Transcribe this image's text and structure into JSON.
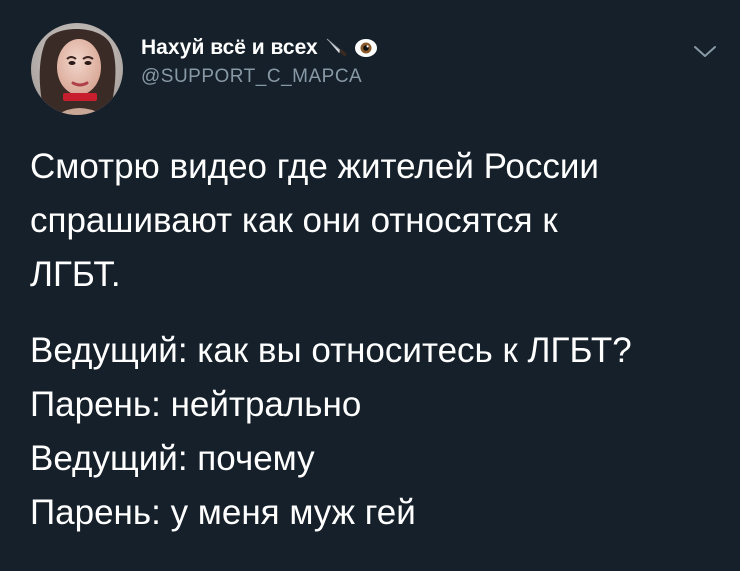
{
  "tweet": {
    "author": {
      "display_name": "Нахуй всё и всех",
      "name_emojis": [
        "knife-icon",
        "eye-icon"
      ],
      "handle": "@SUPPORT_C_MAPCA"
    },
    "paragraph_1": [
      "Смотрю видео где жителей России",
      "спрашивают как они относятся к",
      "ЛГБТ."
    ],
    "paragraph_2": [
      "Ведущий: как вы относитесь к ЛГБТ?",
      "Парень: нейтрально",
      "Ведущий: почему",
      "Парень: у меня муж гей"
    ]
  },
  "colors": {
    "background": "#15202b",
    "text_primary": "#ffffff",
    "text_secondary": "#8899a6"
  }
}
